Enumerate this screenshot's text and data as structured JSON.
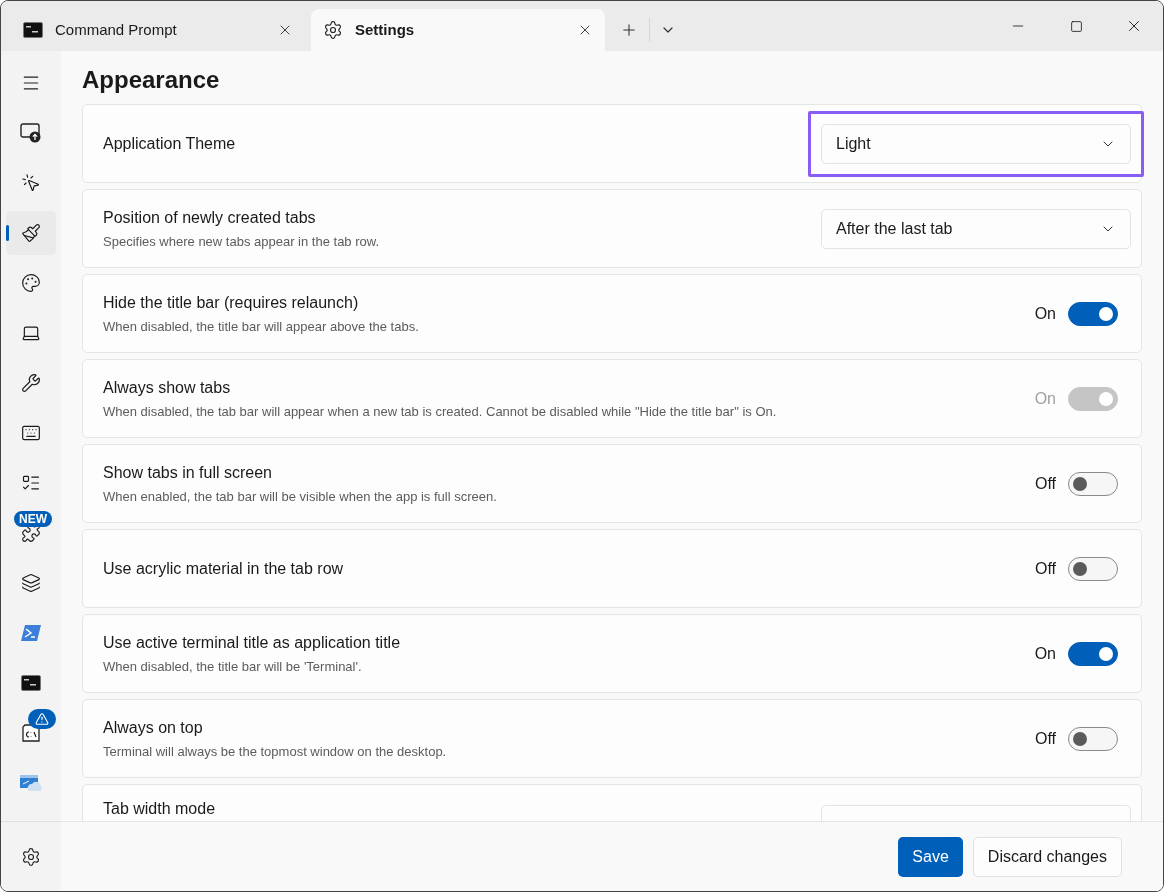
{
  "tabs": [
    {
      "label": "Command Prompt",
      "selected": false,
      "kind": "terminal"
    },
    {
      "label": "Settings",
      "selected": true,
      "kind": "settings"
    }
  ],
  "sidebar": {
    "items": [
      {
        "selected": false
      },
      {
        "selected": false
      },
      {
        "selected": true
      },
      {
        "selected": false
      },
      {
        "selected": false
      },
      {
        "selected": false
      },
      {
        "selected": false
      },
      {
        "selected": false
      },
      {
        "selected": false,
        "badge": "NEW"
      },
      {
        "selected": false
      },
      {
        "selected": false
      },
      {
        "selected": false
      },
      {
        "selected": false,
        "alert": true
      },
      {
        "selected": false
      }
    ]
  },
  "page": {
    "title": "Appearance",
    "settings": [
      {
        "kind": "dropdown",
        "label": "Application Theme",
        "value": "Light",
        "focused": true
      },
      {
        "kind": "dropdown",
        "label": "Position of newly created tabs",
        "description": "Specifies where new tabs appear in the tab row.",
        "value": "After the last tab",
        "focused": false
      },
      {
        "kind": "toggle",
        "label": "Hide the title bar (requires relaunch)",
        "description": "When disabled, the title bar will appear above the tabs.",
        "state_label": "On",
        "on": true,
        "disabled": false
      },
      {
        "kind": "toggle",
        "label": "Always show tabs",
        "description": "When disabled, the tab bar will appear when a new tab is created. Cannot be disabled while \"Hide the title bar\" is On.",
        "state_label": "On",
        "on": true,
        "disabled": true
      },
      {
        "kind": "toggle",
        "label": "Show tabs in full screen",
        "description": "When enabled, the tab bar will be visible when the app is full screen.",
        "state_label": "Off",
        "on": false,
        "disabled": false
      },
      {
        "kind": "toggle",
        "label": "Use acrylic material in the tab row",
        "state_label": "Off",
        "on": false,
        "disabled": false
      },
      {
        "kind": "toggle",
        "label": "Use active terminal title as application title",
        "description": "When disabled, the title bar will be 'Terminal'.",
        "state_label": "On",
        "on": true,
        "disabled": false
      },
      {
        "kind": "toggle",
        "label": "Always on top",
        "description": "Terminal will always be the topmost window on the desktop.",
        "state_label": "Off",
        "on": false,
        "disabled": false
      },
      {
        "kind": "dropdown",
        "label": "Tab width mode",
        "focused": false
      }
    ]
  },
  "footer": {
    "buttons": [
      {
        "label": "Save",
        "kind": "primary"
      },
      {
        "label": "Discard changes",
        "kind": "secondary"
      }
    ]
  }
}
